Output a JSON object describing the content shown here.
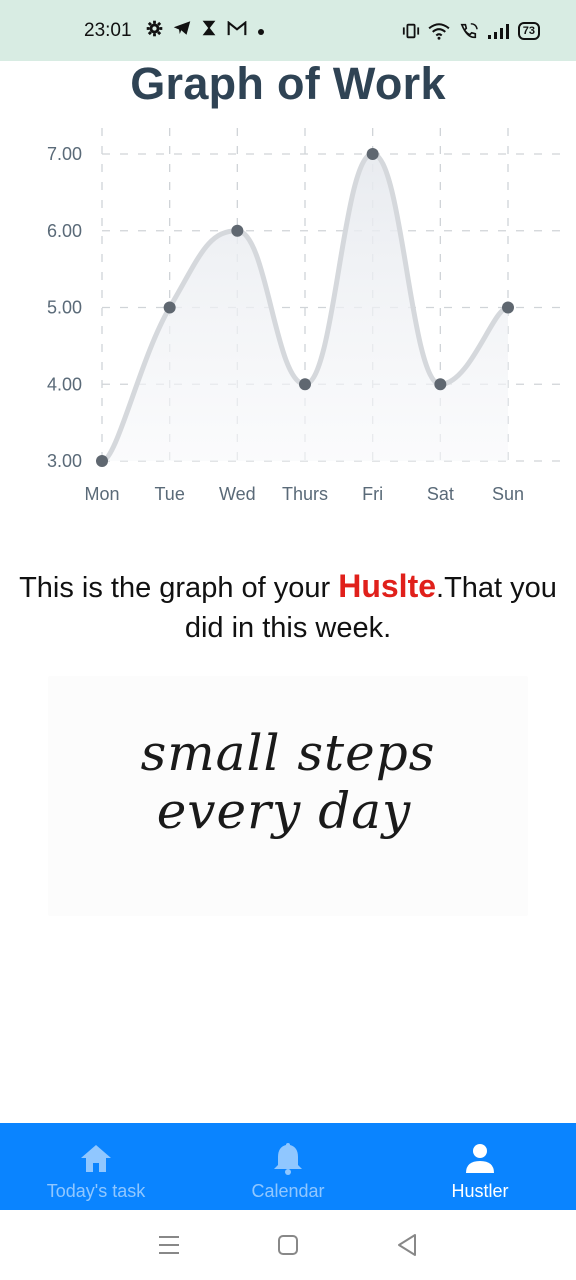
{
  "status_bar": {
    "time": "23:01",
    "battery": "73",
    "left_icons": [
      "settings-icon",
      "telegram-icon",
      "hourglass-icon",
      "gmail-icon",
      "dot-icon"
    ],
    "right_icons": [
      "vibrate-icon",
      "wifi-icon",
      "wifi-calling-icon",
      "signal-icon",
      "battery-icon"
    ]
  },
  "page": {
    "title": "Graph of Work"
  },
  "chart_data": {
    "type": "line",
    "title": "Graph of Work",
    "categories": [
      "Mon",
      "Tue",
      "Wed",
      "Thurs",
      "Fri",
      "Sat",
      "Sun"
    ],
    "values": [
      3,
      5,
      6,
      4,
      7,
      4,
      5
    ],
    "y_ticks": [
      "7.00",
      "6.00",
      "5.00",
      "4.00",
      "3.00"
    ],
    "ylim": [
      3,
      7
    ],
    "grid": true,
    "smooth": true,
    "fill_area": true,
    "colors": {
      "line": "#d5d8dc",
      "point": "#5f6770",
      "fill": "#eef0f3",
      "grid": "#d0d4d8"
    }
  },
  "caption": {
    "before": "This is the graph of your ",
    "highlight": "Huslte",
    "after": ".That you did in this week.",
    "highlight_color": "#e0201b"
  },
  "quote_image": {
    "line1": "small steps",
    "line2": "every day"
  },
  "bottom_nav": {
    "background": "#0a84ff",
    "items": [
      {
        "label": "Today's task",
        "icon": "home-icon",
        "active": false
      },
      {
        "label": "Calendar",
        "icon": "bell-icon",
        "active": false
      },
      {
        "label": "Hustler",
        "icon": "person-icon",
        "active": true
      }
    ]
  },
  "system_nav": {
    "buttons": [
      "recents-icon",
      "home-button-icon",
      "back-icon"
    ]
  }
}
